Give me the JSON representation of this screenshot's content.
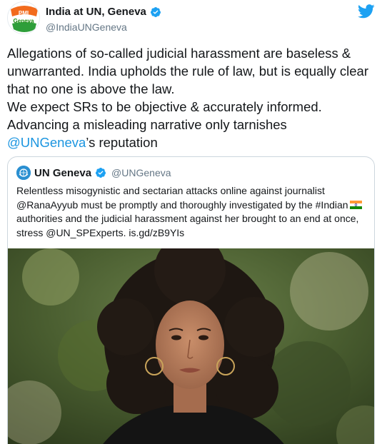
{
  "author": {
    "display_name": "India at UN, Geneva",
    "handle": "@IndiaUNGeneva",
    "avatar_text_top": "PMI",
    "avatar_text_bottom": "Geneva"
  },
  "tweet": {
    "text_part1": "Allegations of so-called judicial harassment are baseless & unwarranted. India upholds the rule of law, but is equally clear that no one is above the law.\nWe expect SRs to be objective & accurately informed. Advancing a misleading narrative only tarnishes ",
    "mention": "@UNGeneva",
    "text_part2": "’s reputation"
  },
  "quoted": {
    "display_name": "UN Geneva",
    "handle": "@UNGeneva",
    "text_part1": "Relentless misogynistic and sectarian attacks online against journalist @RanaAyyub  must be promptly and thoroughly investigated by the #Indian",
    "text_part2": "authorities and the judicial harassment against her brought to an end at once, stress @UN_SPExperts. is.gd/zB9YIs"
  },
  "icons": {
    "verified": "verified-badge-icon",
    "twitter": "twitter-bird-icon",
    "flag": "india-flag-icon"
  },
  "colors": {
    "brand_blue": "#1da1f2",
    "link_blue": "#1b95e0",
    "secondary_text": "#657786",
    "border": "#ccd6dd"
  }
}
